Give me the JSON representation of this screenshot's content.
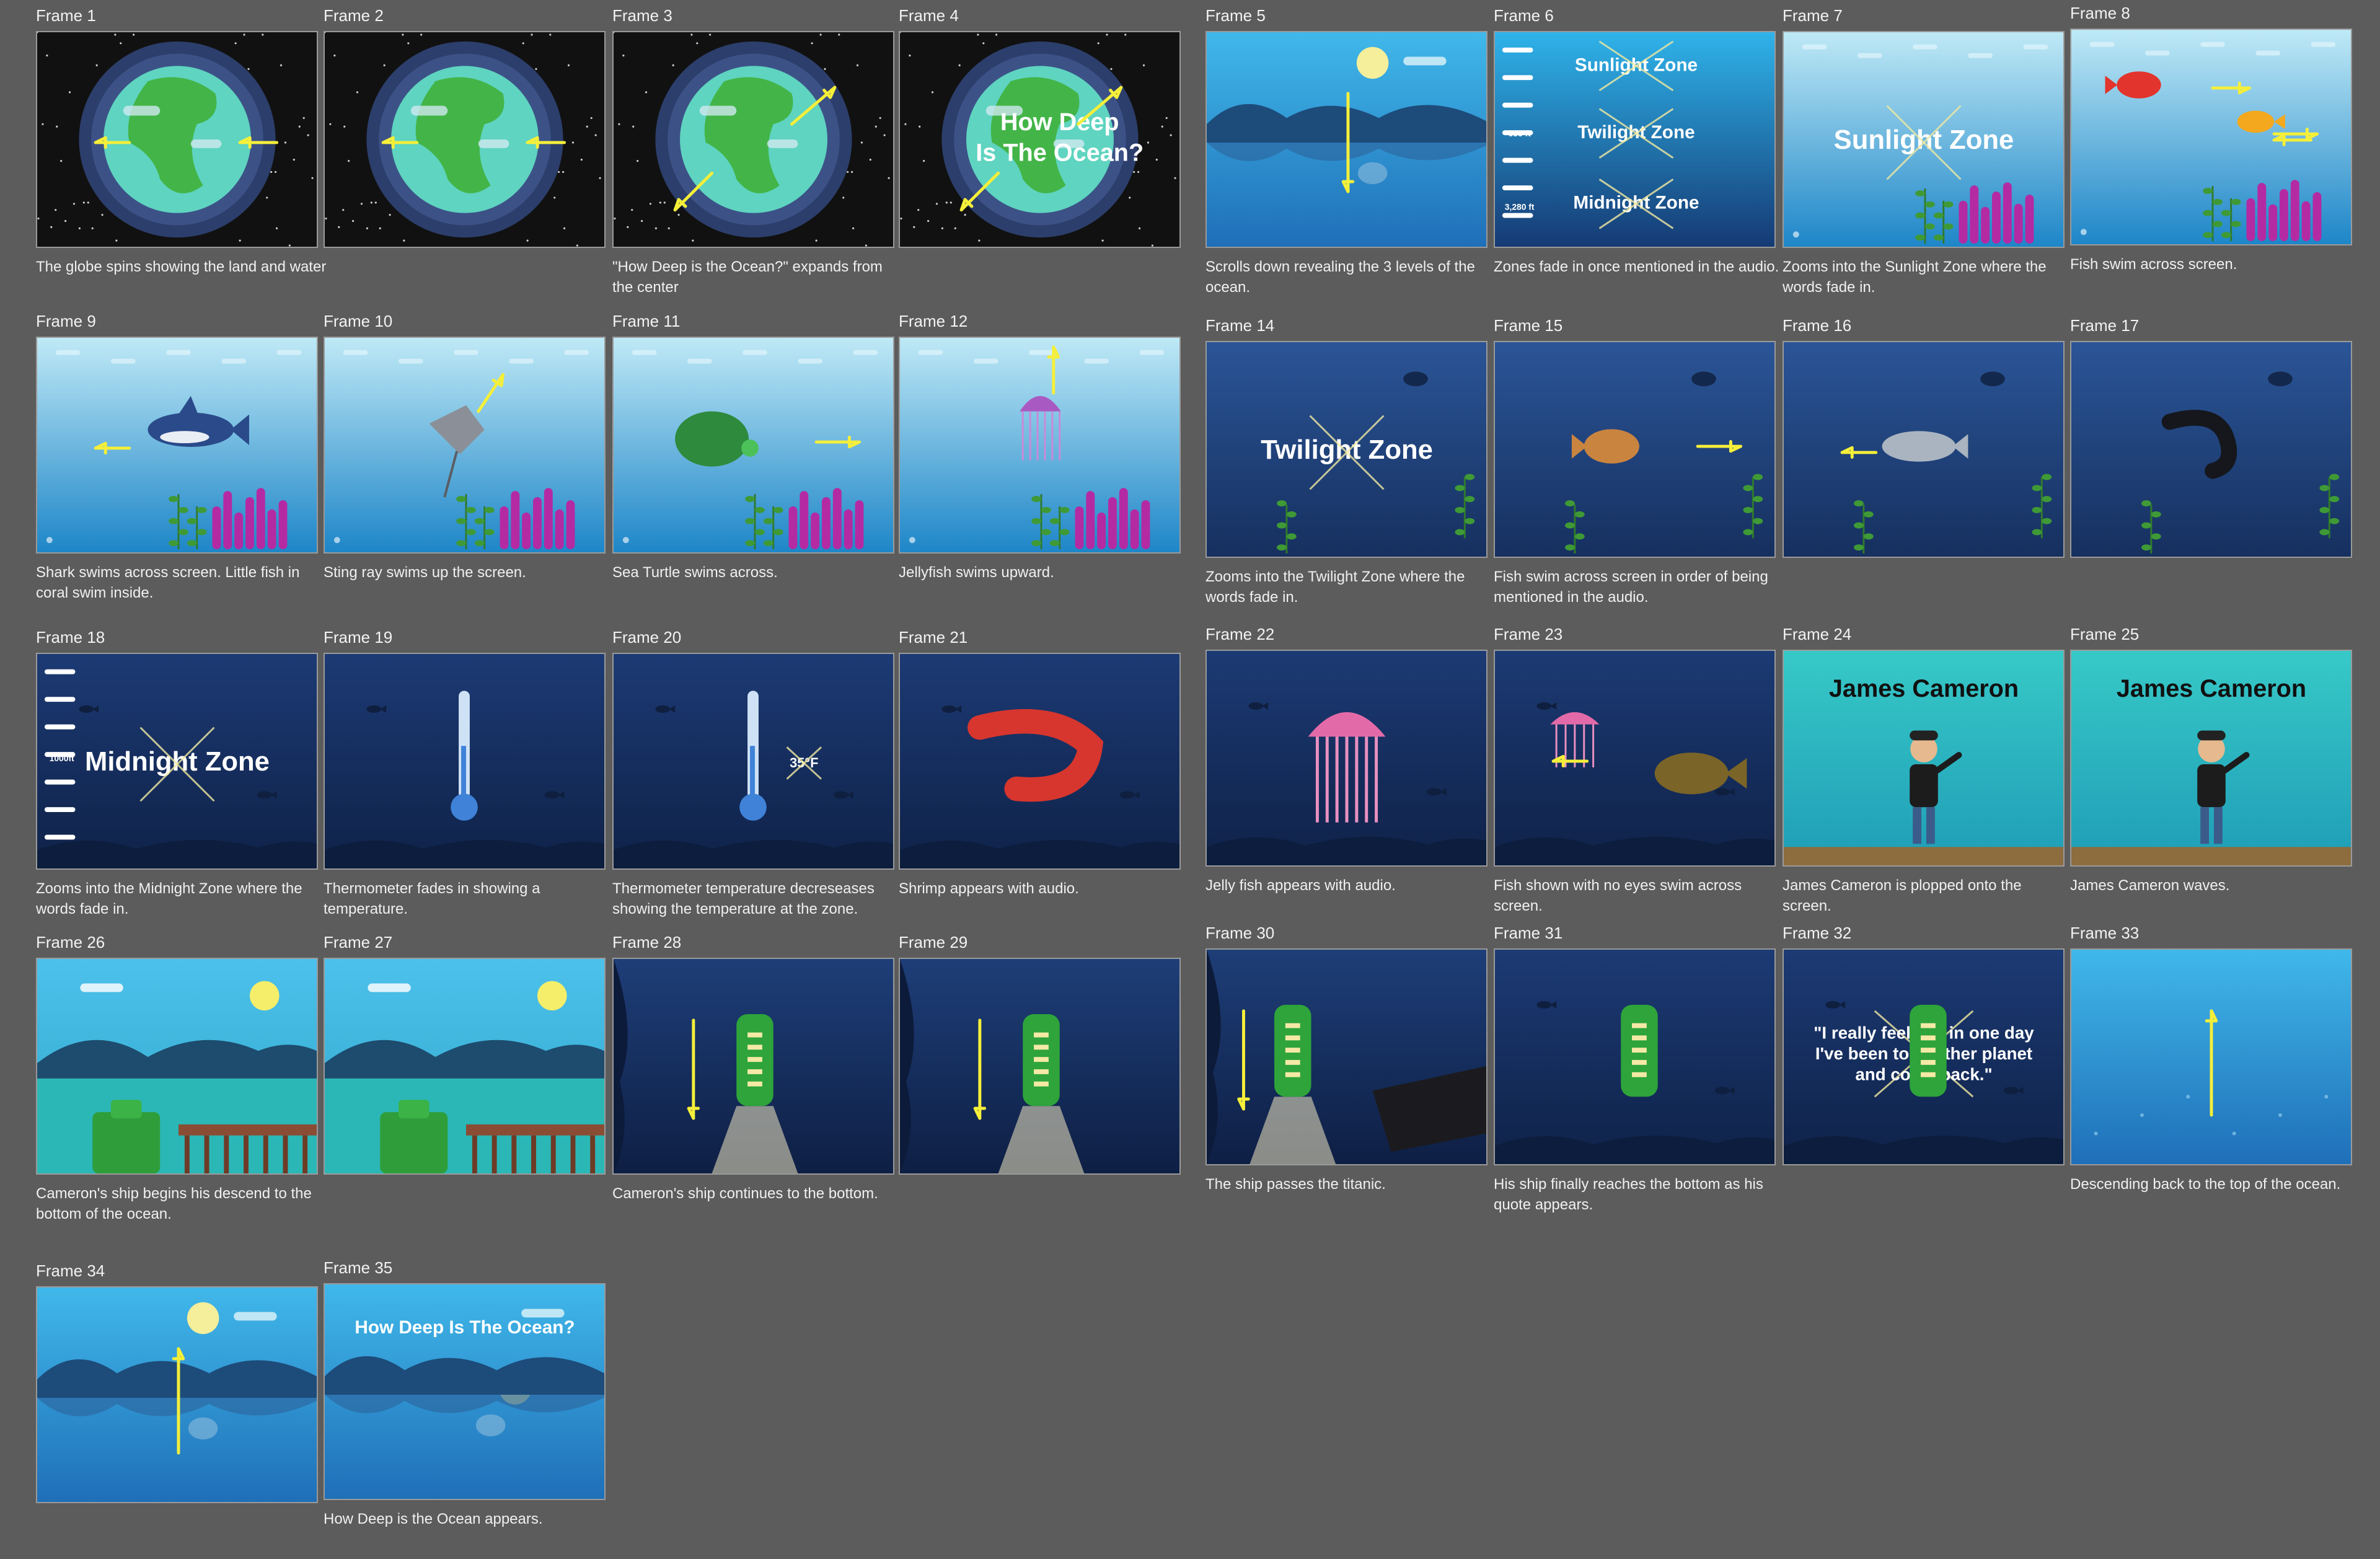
{
  "storyboard": {
    "frames": [
      {
        "label": "Frame 1",
        "caption": "The globe spins showing the land and water",
        "scene": "globe",
        "overlay": "",
        "arrows": [
          "left",
          "left"
        ]
      },
      {
        "label": "Frame 2",
        "caption": "",
        "scene": "globe",
        "overlay": "",
        "arrows": [
          "left",
          "left"
        ]
      },
      {
        "label": "Frame 3",
        "caption": "\"How Deep is the Ocean?\" expands from the center",
        "scene": "globe",
        "overlay": "",
        "arrows": [
          "diag"
        ]
      },
      {
        "label": "Frame 4",
        "caption": "",
        "scene": "globe",
        "overlay": "How Deep\nIs The Ocean?",
        "arrows": [
          "diag"
        ]
      },
      {
        "label": "Frame 5",
        "caption": "Scrolls down revealing the 3 levels of the ocean.",
        "scene": "horizon",
        "overlay": "",
        "arrows": [
          "down"
        ]
      },
      {
        "label": "Frame 6",
        "caption": "Zones fade in once mentioned in the audio.",
        "scene": "zones",
        "overlay": "",
        "zones": [
          "Sunlight Zone",
          "Twilight Zone",
          "Midnight Zone"
        ],
        "depths": [
          "656 ft",
          "3,280 ft"
        ],
        "arrows": []
      },
      {
        "label": "Frame 7",
        "caption": "Zooms into the Sunlight Zone where the words fade in.",
        "scene": "reef",
        "overlay": "Sunlight Zone",
        "arrows": []
      },
      {
        "label": "Frame 8",
        "caption": "Fish swim across screen.",
        "scene": "reef",
        "overlay": "",
        "creature": "fishpair",
        "arrows": [
          "right",
          "left"
        ]
      },
      {
        "label": "Frame 9",
        "caption": "Shark swims across screen. Little fish in coral swim inside.",
        "scene": "reef",
        "overlay": "",
        "creature": "shark",
        "arrows": [
          "left"
        ]
      },
      {
        "label": "Frame 10",
        "caption": "Sting ray swims up the screen.",
        "scene": "reef",
        "overlay": "",
        "creature": "ray",
        "arrows": [
          "upright"
        ]
      },
      {
        "label": "Frame 11",
        "caption": "Sea Turtle swims across.",
        "scene": "reef",
        "overlay": "",
        "creature": "turtle",
        "arrows": [
          "right"
        ]
      },
      {
        "label": "Frame 12",
        "caption": "Jellyfish swims upward.",
        "scene": "reef",
        "overlay": "",
        "creature": "jelly",
        "arrows": [
          "up"
        ]
      },
      {
        "label": "Frame 14",
        "caption": "Zooms into the Twilight Zone where the words fade in.",
        "scene": "twilight",
        "overlay": "Twilight Zone",
        "arrows": []
      },
      {
        "label": "Frame 15",
        "caption": "Fish swim across screen in order of being mentioned in the audio.",
        "scene": "twilight",
        "overlay": "",
        "creature": "brownfish",
        "arrows": [
          "right"
        ]
      },
      {
        "label": "Frame 16",
        "caption": "",
        "scene": "twilight",
        "overlay": "",
        "creature": "greyfish",
        "arrows": [
          "left"
        ]
      },
      {
        "label": "Frame 17",
        "caption": "",
        "scene": "twilight",
        "overlay": "",
        "creature": "eel",
        "arrows": []
      },
      {
        "label": "Frame 18",
        "caption": "Zooms into the Midnight Zone where the words fade in.",
        "scene": "midnight",
        "overlay": "Midnight Zone",
        "depths": [
          "1000ft"
        ],
        "arrows": []
      },
      {
        "label": "Frame 19",
        "caption": "Thermometer fades in showing a temperature.",
        "scene": "midnight",
        "overlay": "",
        "creature": "thermo",
        "arrows": []
      },
      {
        "label": "Frame 20",
        "caption": "Thermometer temperature decreseases showing the temperature at the zone.",
        "scene": "midnight",
        "overlay": "",
        "creature": "thermo",
        "temp": "35°F",
        "arrows": []
      },
      {
        "label": "Frame 21",
        "caption": "Shrimp appears with audio.",
        "scene": "midnight",
        "overlay": "",
        "creature": "shrimp",
        "arrows": []
      },
      {
        "label": "Frame 22",
        "caption": "Jelly fish appears with audio.",
        "scene": "midnight",
        "overlay": "",
        "creature": "bigjelly",
        "arrows": []
      },
      {
        "label": "Frame 23",
        "caption": "Fish shown with no eyes swim across screen.",
        "scene": "midnight",
        "overlay": "",
        "creature": "angler",
        "arrows": [
          "left"
        ]
      },
      {
        "label": "Frame 24",
        "caption": "James Cameron is plopped onto the screen.",
        "scene": "cameron",
        "overlay": "James Cameron",
        "arrows": []
      },
      {
        "label": "Frame 25",
        "caption": "James Cameron waves.",
        "scene": "cameron",
        "overlay": "James Cameron",
        "arrows": []
      },
      {
        "label": "Frame 26",
        "caption": "Cameron's ship begins his descend to the bottom of the ocean.",
        "scene": "dock",
        "overlay": "",
        "arrows": []
      },
      {
        "label": "Frame 27",
        "caption": "",
        "scene": "dock",
        "overlay": "",
        "arrows": []
      },
      {
        "label": "Frame 28",
        "caption": "Cameron's ship continues to the bottom.",
        "scene": "sub",
        "overlay": "",
        "arrows": [
          "down"
        ]
      },
      {
        "label": "Frame 29",
        "caption": "",
        "scene": "sub",
        "overlay": "",
        "arrows": [
          "down"
        ]
      },
      {
        "label": "Frame 30",
        "caption": "The ship passes the titanic.",
        "scene": "titanic",
        "overlay": "",
        "arrows": [
          "down"
        ]
      },
      {
        "label": "Frame 31",
        "caption": "His ship finally reaches the bottom as his quote appears.",
        "scene": "bottom",
        "overlay": "",
        "arrows": []
      },
      {
        "label": "Frame 32",
        "caption": "",
        "scene": "bottom",
        "overlay": "\"I really feel like in one day\nI've been to another planet\nand come back.\"",
        "arrows": []
      },
      {
        "label": "Frame 33",
        "caption": "Descending back to the top of the ocean.",
        "scene": "ascend",
        "overlay": "",
        "arrows": [
          "up"
        ]
      },
      {
        "label": "Frame 34",
        "caption": "",
        "scene": "horizon",
        "overlay": "",
        "arrows": [
          "up"
        ]
      },
      {
        "label": "Frame 35",
        "caption": "How Deep is the Ocean appears.",
        "scene": "horizon",
        "overlay": "How Deep Is The Ocean?",
        "arrows": []
      }
    ]
  },
  "colors": {
    "background": "#5c5c5c",
    "arrow": "#f5ef3a",
    "space": "#111111",
    "reefTop": "#bfe9f6",
    "reefBottom": "#1e86c8",
    "twilight": "#24467e",
    "midnight": "#152a57",
    "coral": "#b42aa3",
    "seaweed": "#3f9a36"
  }
}
